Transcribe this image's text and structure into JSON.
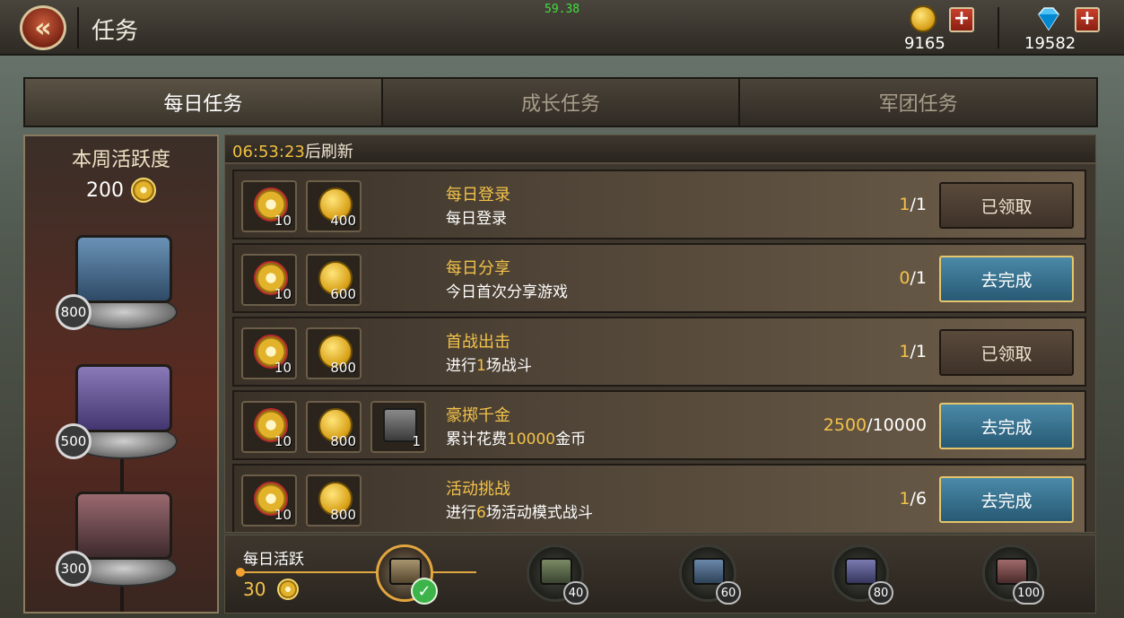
{
  "header": {
    "title": "任务",
    "fps": "59.38",
    "gold": "9165",
    "gems": "19582"
  },
  "tabs": [
    {
      "label": "每日任务",
      "active": true
    },
    {
      "label": "成长任务",
      "active": false
    },
    {
      "label": "军团任务",
      "active": false
    }
  ],
  "weekly": {
    "title": "本周活跃度",
    "value": "200",
    "chests": [
      {
        "threshold": "800",
        "color": "#4a7296"
      },
      {
        "threshold": "500",
        "color": "#6a5a9a"
      },
      {
        "threshold": "300",
        "color": "#7a4850"
      }
    ]
  },
  "refresh": {
    "timer": "06:53:23",
    "suffix": "后刷新"
  },
  "tasks": [
    {
      "name": "每日登录",
      "desc_parts": [
        "每日登录",
        "",
        ""
      ],
      "rewards": [
        {
          "icon": "medal-icon",
          "qty": "10"
        },
        {
          "icon": "gold-coin-icon",
          "qty": "400"
        }
      ],
      "current": "1",
      "total": "/1",
      "button": "已领取",
      "state": "claimed"
    },
    {
      "name": "每日分享",
      "desc_parts": [
        "今日首次分享游戏",
        "",
        ""
      ],
      "rewards": [
        {
          "icon": "medal-icon",
          "qty": "10"
        },
        {
          "icon": "gold-coin-icon",
          "qty": "600"
        }
      ],
      "current": "0",
      "total": "/1",
      "button": "去完成",
      "state": "go"
    },
    {
      "name": "首战出击",
      "desc_parts": [
        "进行",
        "1",
        "场战斗"
      ],
      "rewards": [
        {
          "icon": "medal-icon",
          "qty": "10"
        },
        {
          "icon": "gold-coin-icon",
          "qty": "800"
        }
      ],
      "current": "1",
      "total": "/1",
      "button": "已领取",
      "state": "claimed"
    },
    {
      "name": "豪掷千金",
      "desc_parts": [
        "累计花费",
        "10000",
        "金币"
      ],
      "rewards": [
        {
          "icon": "medal-icon",
          "qty": "10"
        },
        {
          "icon": "gold-coin-icon",
          "qty": "800"
        },
        {
          "icon": "supply-box-icon",
          "qty": "1"
        }
      ],
      "current": "2500",
      "total": "/10000",
      "button": "去完成",
      "state": "go"
    },
    {
      "name": "活动挑战",
      "desc_parts": [
        "进行",
        "6",
        "场活动模式战斗"
      ],
      "rewards": [
        {
          "icon": "medal-icon",
          "qty": "10"
        },
        {
          "icon": "gold-coin-icon",
          "qty": "800"
        }
      ],
      "current": "1",
      "total": "/6",
      "button": "去完成",
      "state": "go"
    }
  ],
  "daily": {
    "label": "每日活跃",
    "value": "30",
    "milestones": [
      {
        "value": "",
        "done": true,
        "color": "#7a6a50"
      },
      {
        "value": "40",
        "done": false,
        "color": "#5a6a4a"
      },
      {
        "value": "60",
        "done": false,
        "color": "#4a6a8a"
      },
      {
        "value": "80",
        "done": false,
        "color": "#5a5a8a"
      },
      {
        "value": "100",
        "done": false,
        "color": "#7a4a4a"
      }
    ]
  }
}
